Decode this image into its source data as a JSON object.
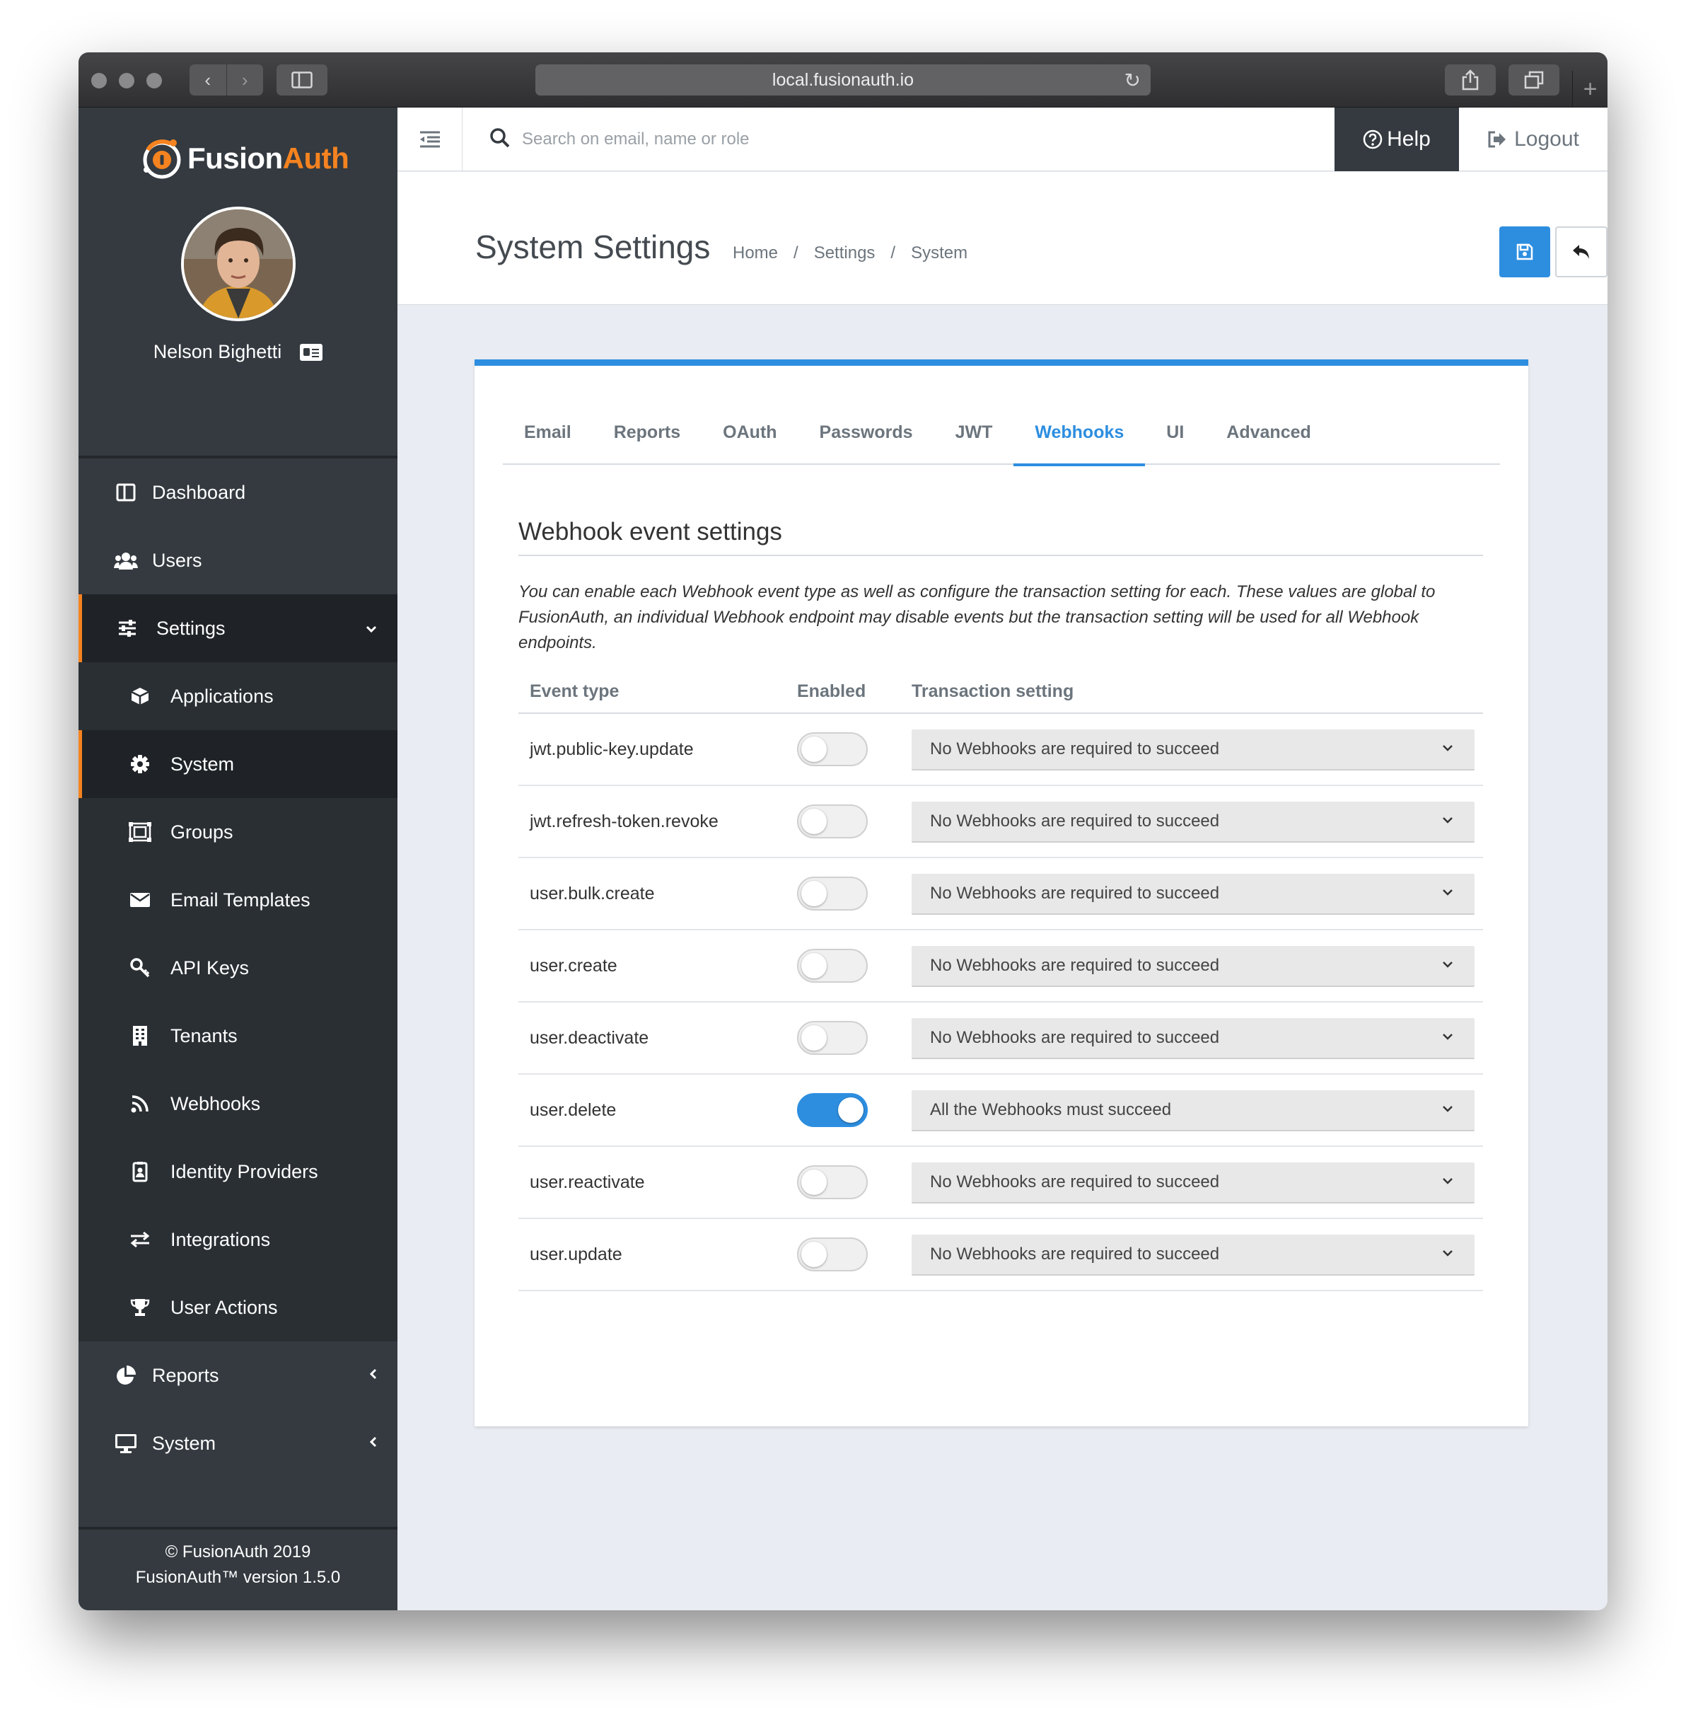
{
  "browser": {
    "url": "local.fusionauth.io"
  },
  "brand": {
    "name_first": "Fusion",
    "name_second": "Auth",
    "accent_color": "#f58320",
    "primary_color": "#2d8ee0"
  },
  "user": {
    "name": "Nelson Bighetti"
  },
  "sidebar": {
    "items": [
      {
        "label": "Dashboard",
        "icon": "dashboard-icon"
      },
      {
        "label": "Users",
        "icon": "users-icon"
      },
      {
        "label": "Settings",
        "icon": "sliders-icon",
        "expanded": true
      },
      {
        "label": "Applications",
        "icon": "cube-icon"
      },
      {
        "label": "System",
        "icon": "gear-icon",
        "active": true
      },
      {
        "label": "Groups",
        "icon": "groups-icon"
      },
      {
        "label": "Email Templates",
        "icon": "envelope-icon"
      },
      {
        "label": "API Keys",
        "icon": "key-icon"
      },
      {
        "label": "Tenants",
        "icon": "building-icon"
      },
      {
        "label": "Webhooks",
        "icon": "rss-icon"
      },
      {
        "label": "Identity Providers",
        "icon": "id-badge-icon"
      },
      {
        "label": "Integrations",
        "icon": "exchange-icon"
      },
      {
        "label": "User Actions",
        "icon": "trophy-icon"
      },
      {
        "label": "Reports",
        "icon": "pie-chart-icon"
      },
      {
        "label": "System",
        "icon": "desktop-icon"
      }
    ],
    "footer_line1": "© FusionAuth 2019",
    "footer_line2": "FusionAuth™ version 1.5.0"
  },
  "topbar": {
    "search_placeholder": "Search on email, name or role",
    "help_label": "Help",
    "logout_label": "Logout"
  },
  "header": {
    "title": "System Settings",
    "breadcrumb": [
      "Home",
      "Settings",
      "System"
    ]
  },
  "tabs": [
    {
      "label": "Email"
    },
    {
      "label": "Reports"
    },
    {
      "label": "OAuth"
    },
    {
      "label": "Passwords"
    },
    {
      "label": "JWT"
    },
    {
      "label": "Webhooks",
      "active": true
    },
    {
      "label": "UI"
    },
    {
      "label": "Advanced"
    }
  ],
  "section": {
    "title": "Webhook event settings",
    "description": "You can enable each Webhook event type as well as configure the transaction setting for each. These values are global to FusionAuth, an individual Webhook endpoint may disable events but the transaction setting will be used for all Webhook endpoints."
  },
  "table": {
    "headers": {
      "event": "Event type",
      "enabled": "Enabled",
      "transaction": "Transaction setting"
    },
    "rows": [
      {
        "event": "jwt.public-key.update",
        "enabled": false,
        "transaction": "No Webhooks are required to succeed"
      },
      {
        "event": "jwt.refresh-token.revoke",
        "enabled": false,
        "transaction": "No Webhooks are required to succeed"
      },
      {
        "event": "user.bulk.create",
        "enabled": false,
        "transaction": "No Webhooks are required to succeed"
      },
      {
        "event": "user.create",
        "enabled": false,
        "transaction": "No Webhooks are required to succeed"
      },
      {
        "event": "user.deactivate",
        "enabled": false,
        "transaction": "No Webhooks are required to succeed"
      },
      {
        "event": "user.delete",
        "enabled": true,
        "transaction": "All the Webhooks must succeed"
      },
      {
        "event": "user.reactivate",
        "enabled": false,
        "transaction": "No Webhooks are required to succeed"
      },
      {
        "event": "user.update",
        "enabled": false,
        "transaction": "No Webhooks are required to succeed"
      }
    ]
  }
}
